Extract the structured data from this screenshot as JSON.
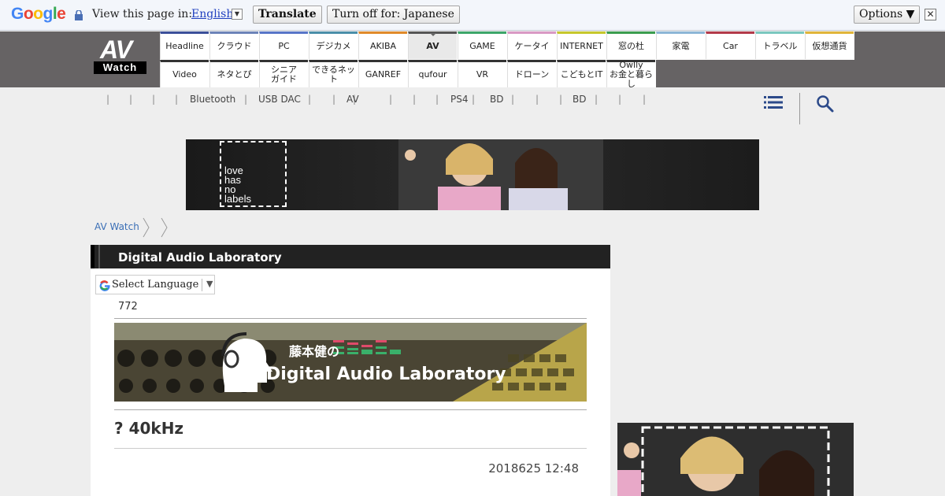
{
  "translate_bar": {
    "brand": "Google",
    "view_text": "View this page in:",
    "language": "English",
    "translate_label": "Translate",
    "turn_off_label": "Turn off for: Japanese",
    "options_label": "Options ▼",
    "close_glyph": "✕"
  },
  "logo": {
    "av": "AV",
    "watch": "Watch"
  },
  "nav": {
    "row1": [
      {
        "label": "Headline",
        "color": "#3b4f9a"
      },
      {
        "label": "クラウド",
        "color": "#6c83b8"
      },
      {
        "label": "PC",
        "color": "#5875c8"
      },
      {
        "label": "デジカメ",
        "color": "#4b8fa9"
      },
      {
        "label": "AKIBA",
        "color": "#e08a2a"
      },
      {
        "label": "AV",
        "color": "#555555"
      },
      {
        "label": "GAME",
        "color": "#3da66a"
      },
      {
        "label": "ケータイ",
        "color": "#d999c4"
      },
      {
        "label": "INTERNET",
        "color": "#c6c72c"
      },
      {
        "label": "窓の杜",
        "color": "#3b9d4f"
      },
      {
        "label": "家電",
        "color": "#8cb6d6"
      },
      {
        "label": "Car",
        "color": "#b33a4a"
      },
      {
        "label": "トラベル",
        "color": "#7ac7bf"
      },
      {
        "label": "仮想通貨",
        "color": "#e0b53a"
      }
    ],
    "row2": [
      {
        "label": "Video"
      },
      {
        "label": "ネタとぴ"
      },
      {
        "label": "シニア\nガイド"
      },
      {
        "label": "できるネット"
      },
      {
        "label": "GANREF"
      },
      {
        "label": "qufour"
      },
      {
        "label": "VR"
      },
      {
        "label": "ドローン"
      },
      {
        "label": "こどもとIT"
      },
      {
        "label": "Owlly\nお金と暮らし"
      }
    ],
    "active": "AV"
  },
  "subnav": {
    "items": [
      "Bluetooth",
      "USB DAC",
      "AV",
      "PS4",
      "BD",
      "BD"
    ],
    "separator": "|"
  },
  "banner": {
    "text": "love\nhas\nno\nlabels"
  },
  "breadcrumb": {
    "root": "AV Watch"
  },
  "article": {
    "section_title": "Digital Audio Laboratory",
    "select_language": "Select Language",
    "select_arrow": "▼",
    "count": "772",
    "dal_jp": "藤本健の",
    "dal_en": "Digital Audio Laboratory",
    "headline": "? 40kHz",
    "date": "2018625 12:48"
  },
  "colors": {
    "header_bg": "#666364",
    "link": "#3b6fb6",
    "title_bar": "#222222"
  }
}
